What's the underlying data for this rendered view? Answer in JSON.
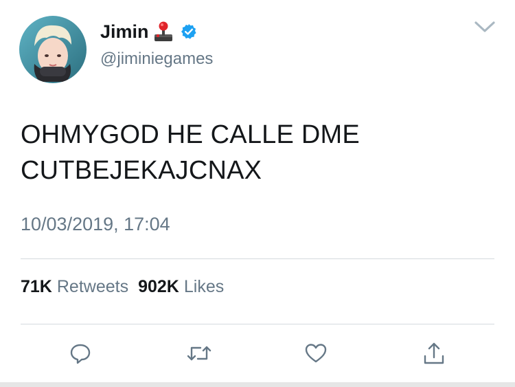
{
  "user": {
    "display_name": "Jimin",
    "handle": "@jiminiegames",
    "verified": true,
    "name_emoji_icon": "joystick-icon"
  },
  "tweet": {
    "lines": [
      "OHMYGOD HE CALLE DME",
      "CUTBEJEKAJCNAX"
    ],
    "timestamp": "10/03/2019, 17:04"
  },
  "stats": {
    "retweets_count": "71K",
    "retweets_label": "Retweets",
    "likes_count": "902K",
    "likes_label": "Likes"
  },
  "actions": [
    "reply-icon",
    "retweet-icon",
    "like-icon",
    "share-icon"
  ],
  "colors": {
    "text_primary": "#14171a",
    "text_secondary": "#657786",
    "verified_blue": "#1da1f2",
    "divider": "#d4d9de"
  }
}
